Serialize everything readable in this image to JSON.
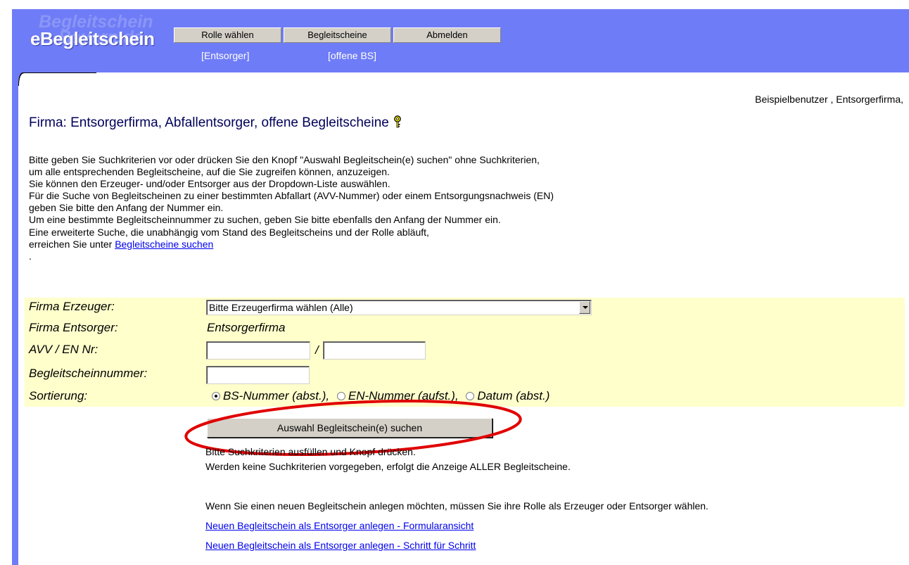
{
  "logo": {
    "watermark_line1": "Begleitschein",
    "watermark_line2": "Bayern.de",
    "text": "eBegleitschein"
  },
  "nav": {
    "buttons": [
      "Rolle wählen",
      "Begleitscheine",
      "Abmelden"
    ],
    "role_status": "[Entsorger]",
    "bs_status": "[offene BS]"
  },
  "user_info": "Beispielbenutzer , Entsorgerfirma,",
  "page_title": "Firma: Entsorgerfirma, Abfallentsorger, offene Begleitscheine",
  "intro": {
    "lines": [
      "Bitte geben Sie Suchkriterien vor oder drücken Sie den Knopf \"Auswahl Begleitschein(e) suchen\" ohne Suchkriterien,",
      "um alle entsprechenden Begleitscheine, auf die Sie zugreifen können, anzuzeigen.",
      "Sie können den Erzeuger- und/oder Entsorger aus der Dropdown-Liste auswählen.",
      "Für die Suche von Begleitscheinen zu einer bestimmten Abfallart (AVV-Nummer) oder einem Entsorgungsnachweis (EN)",
      "geben Sie bitte den Anfang der Nummer ein.",
      "Um eine bestimmte Begleitscheinnummer zu suchen, geben Sie bitte ebenfalls den Anfang der Nummer ein.",
      "Eine erweiterte Suche, die unabhängig vom Stand des Begleitscheins und der Rolle abläuft,"
    ],
    "last_line_prefix": "erreichen Sie unter ",
    "last_line_link": "Begleitscheine suchen",
    "dot": "."
  },
  "form": {
    "erzeuger_label": "Firma Erzeuger:",
    "erzeuger_selected": "Bitte Erzeugerfirma wählen (Alle)",
    "entsorger_label": "Firma Entsorger:",
    "entsorger_value": "Entsorgerfirma",
    "avv_label": "AVV / EN Nr:",
    "avv_separator": "/",
    "bs_number_label": "Begleitscheinnummer:",
    "sort_label": "Sortierung:",
    "sort_options": [
      "BS-Nummer (abst.),",
      "EN-Nummer (aufst.),",
      "Datum (abst.)"
    ],
    "sort_selected_index": 0
  },
  "search_button": "Auswahl Begleitschein(e) suchen",
  "notes": {
    "hint1": "Bitte Suchkriterien ausfüllen und Knopf drücken.",
    "hint2": "Werden keine Suchkriterien vorgegeben, erfolgt die Anzeige ALLER Begleitscheine.",
    "new_info": "Wenn Sie einen neuen Begleitschein anlegen möchten, müssen Sie ihre Rolle als Erzeuger oder Entsorger wählen."
  },
  "links": {
    "new_form": "Neuen Begleitschein als Entsorger anlegen - Formularansicht",
    "new_steps": "Neuen Begleitschein als Entsorger anlegen - Schritt für Schritt"
  },
  "colors": {
    "header_blue": "#6f7cf7",
    "form_bg": "#ffffcc",
    "title": "#00005a",
    "link": "#0000ee",
    "annotation_red": "#e00000"
  }
}
